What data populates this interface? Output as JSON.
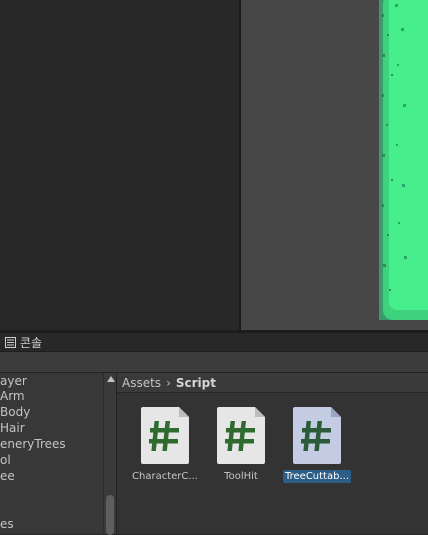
{
  "console_tab": {
    "label": "콘솔"
  },
  "hierarchy": {
    "items": [
      {
        "label": "ayer"
      },
      {
        "label": "Arm"
      },
      {
        "label": "Body"
      },
      {
        "label": "Hair"
      },
      {
        "label": "eneryTrees"
      },
      {
        "label": "ol"
      },
      {
        "label": "ee"
      },
      {
        "label": "es"
      }
    ]
  },
  "breadcrumb": {
    "root": "Assets",
    "current": "Script"
  },
  "assets": [
    {
      "label": "CharacterC...",
      "icon": "csharp-script-icon",
      "selected": false
    },
    {
      "label": "ToolHit",
      "icon": "csharp-script-icon",
      "selected": false
    },
    {
      "label": "TreeCuttab...",
      "icon": "csharp-script-icon",
      "selected": true
    }
  ],
  "colors": {
    "selection": "#2c5d87",
    "hash": "#2f6a2e",
    "sprite_green": "#3ff08a"
  }
}
